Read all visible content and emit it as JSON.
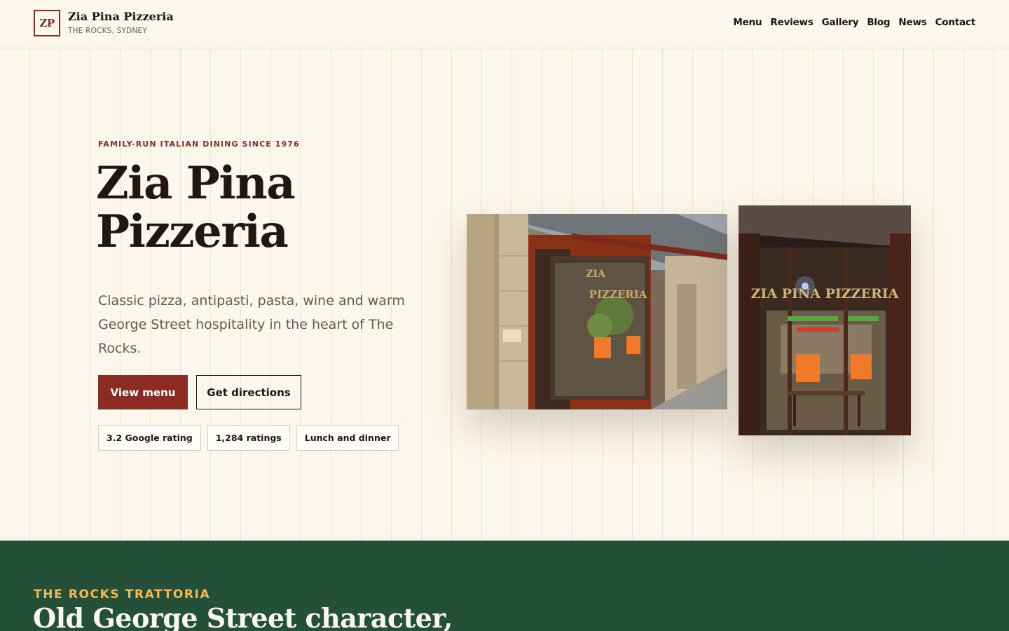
{
  "header": {
    "logo_mark": "ZP",
    "brand_name": "Zia Pina Pizzeria",
    "brand_location": "THE ROCKS, SYDNEY",
    "nav": [
      "Menu",
      "Reviews",
      "Gallery",
      "Blog",
      "News",
      "Contact"
    ]
  },
  "hero": {
    "eyebrow": "FAMILY-RUN ITALIAN DINING SINCE 1976",
    "title": "Zia Pina Pizzeria",
    "description": "Classic pizza, antipasti, pasta, wine and warm George Street hospitality in the heart of The Rocks.",
    "primary_button": "View menu",
    "secondary_button": "Get directions",
    "chips": [
      "3.2 Google rating",
      "1,284 ratings",
      "Lunch and dinner"
    ],
    "photo_sign_text": "ZIA PINA PIZZERIA"
  },
  "story": {
    "eyebrow": "THE ROCKS TRATTORIA",
    "title": "Old George Street character,"
  },
  "colors": {
    "brand_red": "#8d2b22",
    "cream": "#fcf7ec",
    "forest_green": "#24503a",
    "gold": "#f0b955",
    "ink": "#23150f"
  }
}
